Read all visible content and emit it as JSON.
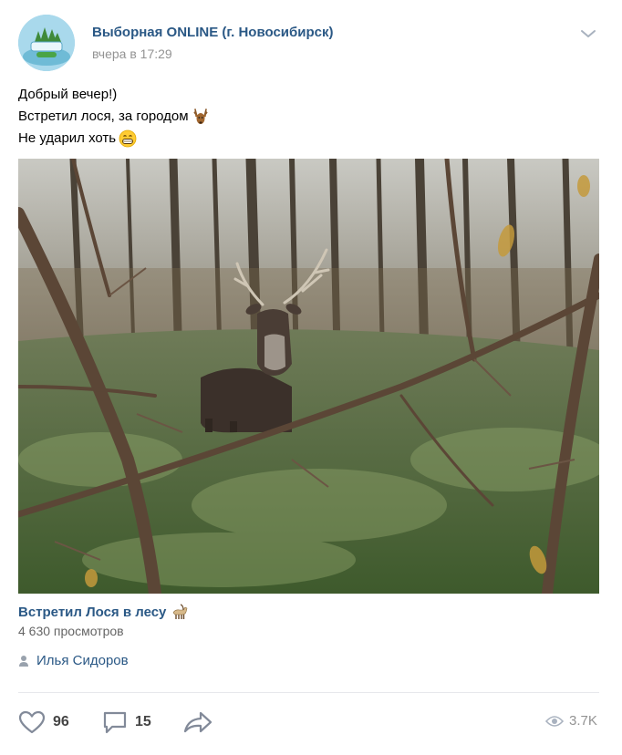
{
  "post": {
    "author": "Выборная ONLINE (г. Новосибирск)",
    "time": "вчера в 17:29",
    "text_lines": [
      "Добрый вечер!)",
      "Встретил лося, за городом",
      "Не ударил хоть"
    ],
    "video": {
      "title": "Встретил Лося в лесу",
      "views": "4 630 просмотров"
    },
    "signer": "Илья Сидоров",
    "likes": "96",
    "comments": "15",
    "views_count": "3.7K"
  },
  "icons": {
    "avatar": "group-logo-icon",
    "menu": "chevron-down-icon",
    "deer": "deer-emoji-icon",
    "grin": "grinning-face-emoji-icon",
    "goat": "goat-emoji-icon",
    "signer": "person-icon",
    "like": "heart-icon",
    "comment": "comment-icon",
    "share": "share-icon",
    "views": "eye-icon"
  },
  "colors": {
    "link": "#2a5885",
    "secondary": "#939393",
    "icon": "#828a99",
    "divider": "#e7e8ec"
  }
}
